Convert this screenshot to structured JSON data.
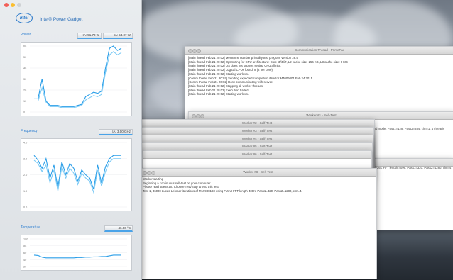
{
  "gadget": {
    "title": "Intel® Power Gadget",
    "logo_text": "intel",
    "panels": [
      {
        "key": "power",
        "label": "Power",
        "readouts": [
          "IA: 51.70 W",
          "IA: 53.07 W"
        ],
        "y_ticks": [
          "60",
          "50",
          "40",
          "30",
          "20",
          "10",
          "0"
        ],
        "series": [
          [
            12,
            12,
            30,
            10,
            6,
            6,
            6,
            5,
            5,
            5,
            5,
            6,
            7,
            14,
            16,
            18,
            17,
            19,
            40,
            58,
            60,
            56,
            58
          ],
          [
            10,
            10,
            22,
            9,
            5,
            5,
            5,
            4,
            4,
            4,
            4,
            5,
            6,
            11,
            13,
            15,
            14,
            16,
            36,
            52,
            55,
            52,
            54
          ]
        ]
      },
      {
        "key": "frequency",
        "label": "Frequency",
        "readouts": [
          "IA: 3.00 GHz"
        ],
        "y_ticks": [
          "4.0",
          "3.0",
          "2.0",
          "1.0",
          "0.0"
        ],
        "series": [
          [
            3.2,
            2.9,
            2.4,
            3.0,
            1.8,
            2.6,
            1.2,
            2.8,
            2.0,
            2.7,
            2.4,
            1.6,
            2.3,
            2.0,
            1.8,
            1.1,
            2.6,
            1.5,
            2.5,
            3.0,
            3.2,
            3.2,
            3.2
          ],
          [
            2.9,
            2.7,
            2.2,
            2.6,
            1.5,
            2.3,
            1.0,
            2.5,
            1.8,
            2.4,
            2.1,
            1.4,
            2.1,
            1.8,
            1.6,
            0.9,
            2.3,
            1.3,
            2.2,
            2.8,
            3.0,
            3.0,
            3.0
          ]
        ]
      },
      {
        "key": "temperature",
        "label": "Temperature",
        "readouts": [
          "46.00 °C"
        ],
        "y_ticks": [
          "100",
          "80",
          "60",
          "40",
          "20"
        ],
        "series": [
          [
            53,
            52,
            47,
            45,
            45,
            45,
            45,
            45,
            45,
            45,
            45,
            46,
            46,
            47,
            47,
            48,
            48,
            49,
            49,
            51,
            53,
            53,
            53
          ]
        ]
      }
    ]
  },
  "console": {
    "title": "Communication Thread - PrimeFax",
    "lines": [
      "[Main thread Feb 21 20:02] Mersenne number primality test program version 28.5",
      "[Main thread Feb 21 20:02] Optimizing for CPU architecture: Core i3/i5/i7, L2 cache size: 256 KB, L3 cache size: 6 MB",
      "[Main thread Feb 21 20:02] OS does not support setting CPU affinity.",
      "[Main thread Feb 21 20:02] Logical CPUs found: 8 (2 per core)",
      "[Main thread Feb 21 20:02] Starting workers.",
      "[Comm thread Feb 21 20:02] Sending expected completion date for M4006001 Feb 24 2015",
      "[Comm thread Feb 21 20:02] Done communicating with server.",
      "[Main thread Feb 21 20:02] Stopping all worker threads.",
      "[Main thread Feb 21 20:02] Execution halted.",
      "[Main thread Feb 21 20:02] Starting workers."
    ]
  },
  "workers": [
    {
      "title": "Worker #1 - Self-Test",
      "text": "Self-test 4K FFT in background mode. Pass1=128, Pass2=384, clm=1, 4 threads"
    },
    {
      "title": "Worker #2 - Self-Test"
    },
    {
      "title": "Worker #3 - Self-Test"
    },
    {
      "title": "Worker #4 - Self-Test"
    },
    {
      "title": "Worker #5 - Self-Test"
    },
    {
      "title": "Worker #6 - Self-Test"
    },
    {
      "title": "Worker #7 - Self-Test",
      "text": "Self-test 1536K FFT length 4096, Pass1=320, Pass2=1280, clm=4"
    },
    {
      "title": "Worker #8 - Self-Test",
      "lines": [
        "Worker starting",
        "Beginning a continuous self-test on your computer.",
        "Please read stress.txt.  Choose Test/Stop to end this test.",
        "Test 1, 36000 Lucas-Lehmer iterations of M19988193 using FMA3 FFT length 400K, Pass1=320, Pass2=1280, clm=4."
      ]
    }
  ]
}
